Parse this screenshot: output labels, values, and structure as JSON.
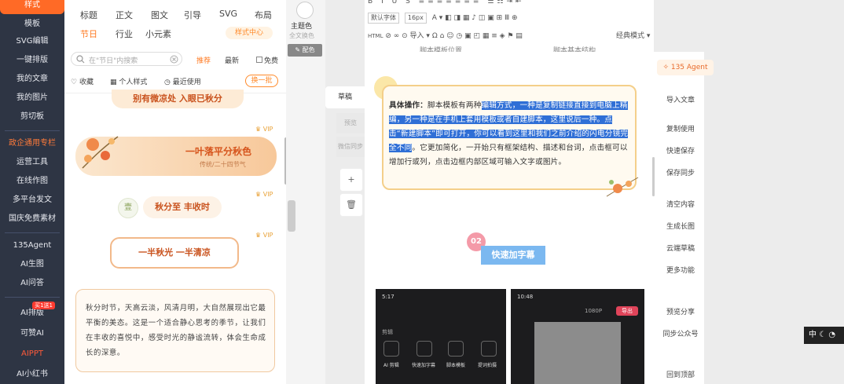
{
  "left_nav": {
    "items": [
      "样式",
      "模板",
      "SVG编辑",
      "一键排版",
      "我的文章",
      "我的图片",
      "剪切板",
      "政企通用专栏",
      "运营工具",
      "在线作图",
      "多平台发文",
      "国庆免费素材",
      "135Agent",
      "AI生图",
      "AI问答",
      "AI排版",
      "可赞AI",
      "AIPPT",
      "AI小红书"
    ],
    "badge": "买1送1"
  },
  "style_panel": {
    "categories_row1": [
      "标题",
      "正文",
      "图文",
      "引导",
      "SVG",
      "布局"
    ],
    "categories_row2": [
      "节日",
      "行业",
      "小元素"
    ],
    "style_center": "样式中心",
    "search_placeholder": "在\"节日\"内搜索",
    "filters": [
      "推荐",
      "最新",
      "免费"
    ],
    "tools": [
      "收藏",
      "个人样式",
      "最近使用"
    ],
    "swap_button": "换一批",
    "vip": "VIP",
    "cards": {
      "top_partial": "别有微凉处 入眼已秋分",
      "card1_title": "一叶落平分秋色",
      "card1_sub": "传统/二十四节气",
      "card2_circle": "壹",
      "card2_title": "秋分至 丰收时",
      "card3_title": "一半秋光 一半清凉",
      "text_card": "秋分时节，天高云淡，风清月明，大自然展现出它最平衡的美态。这是一个适合静心思考的季节，让我们在丰收的喜悦中，感受时光的静谧流转，体会生命成长的深意。"
    }
  },
  "mid_strip": {
    "theme_color": "主题色",
    "full_text_color": "全文换色",
    "tag": "配色"
  },
  "editor_side": {
    "draft": "草稿",
    "btn1": "预览",
    "btn2": "微信同步",
    "add": "+",
    "trash": "🗑"
  },
  "toolbar": {
    "font": "默认字体",
    "size": "16px",
    "import": "导入",
    "classic_mode": "经典模式",
    "caption_left": "脚本模板位置",
    "caption_right": "脚本基本结构"
  },
  "article": {
    "label": "具体操作：",
    "intro": "脚本模板有两种",
    "selected": "编辑方式，一种是复制链接直接到电脑上精编，另一种是在手机上套用模板或者自建脚本，这里说后一种。点击“新建脚本”即可打开，你可以看到这里和我们之前介绍的闪电分镜完全不同",
    "rest": "。它更加简化，一开始只有框架结构、描述和台词，点击框可以增加行或列，点击边框内部区域可输入文字或图片。",
    "number": "02",
    "subtitle": "快速加字幕"
  },
  "phone1": {
    "time": "5:17",
    "label_ai": "AI 剪辑",
    "label2": "快速加字幕",
    "label3": "脚本模板",
    "label4": "提词拍摄",
    "section": "剪辑"
  },
  "phone2": {
    "time": "10:48",
    "res": "1080P",
    "export": "导出"
  },
  "right_panel": {
    "agent": "135 Agent",
    "buttons": [
      "导入文章",
      "复制使用",
      "快速保存",
      "保存同步",
      "清空内容",
      "生成长图",
      "云端草稿",
      "更多功能",
      "预览分享",
      "同步公众号",
      "回到顶部"
    ]
  },
  "lang_bar": "中"
}
